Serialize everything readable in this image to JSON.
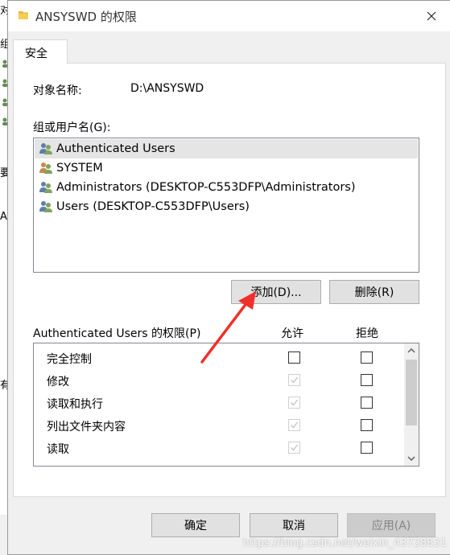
{
  "background_window": {
    "fragments": [
      "对",
      "组",
      "要",
      "A",
      "有"
    ]
  },
  "titlebar": {
    "title": "ANSYSWD 的权限",
    "folder_icon": "folder-icon",
    "close_icon": "close-icon"
  },
  "tabs": [
    {
      "label": "安全",
      "active": true
    }
  ],
  "object": {
    "label": "对象名称:",
    "value": "D:\\ANSYSWD"
  },
  "groups": {
    "label": "组或用户名(G):",
    "items": [
      {
        "label": "Authenticated Users",
        "selected": true
      },
      {
        "label": "SYSTEM",
        "selected": false
      },
      {
        "label": "Administrators (DESKTOP-C553DFP\\Administrators)",
        "selected": false
      },
      {
        "label": "Users (DESKTOP-C553DFP\\Users)",
        "selected": false
      }
    ],
    "icon": "user-group-icon"
  },
  "buttons": {
    "add": "添加(D)...",
    "remove": "删除(R)"
  },
  "permissions": {
    "label": "Authenticated Users 的权限(P)",
    "allow_header": "允许",
    "deny_header": "拒绝",
    "rows": [
      {
        "name": "完全控制",
        "allow": false,
        "allow_disabled": false,
        "deny": false
      },
      {
        "name": "修改",
        "allow": true,
        "allow_disabled": true,
        "deny": false
      },
      {
        "name": "读取和执行",
        "allow": true,
        "allow_disabled": true,
        "deny": false
      },
      {
        "name": "列出文件夹内容",
        "allow": true,
        "allow_disabled": true,
        "deny": false
      },
      {
        "name": "读取",
        "allow": true,
        "allow_disabled": true,
        "deny": false
      }
    ]
  },
  "footer": {
    "ok": "确定",
    "cancel": "取消",
    "apply": "应用(A)"
  },
  "annotation": {
    "color": "#f0302a"
  },
  "watermark": "https://blog.csdn.net/weixin_43728831",
  "colors": {
    "selection": "#e5e5e5",
    "button_face": "#e1e1e1",
    "button_border": "#adadad",
    "disabled_text": "#838383"
  }
}
